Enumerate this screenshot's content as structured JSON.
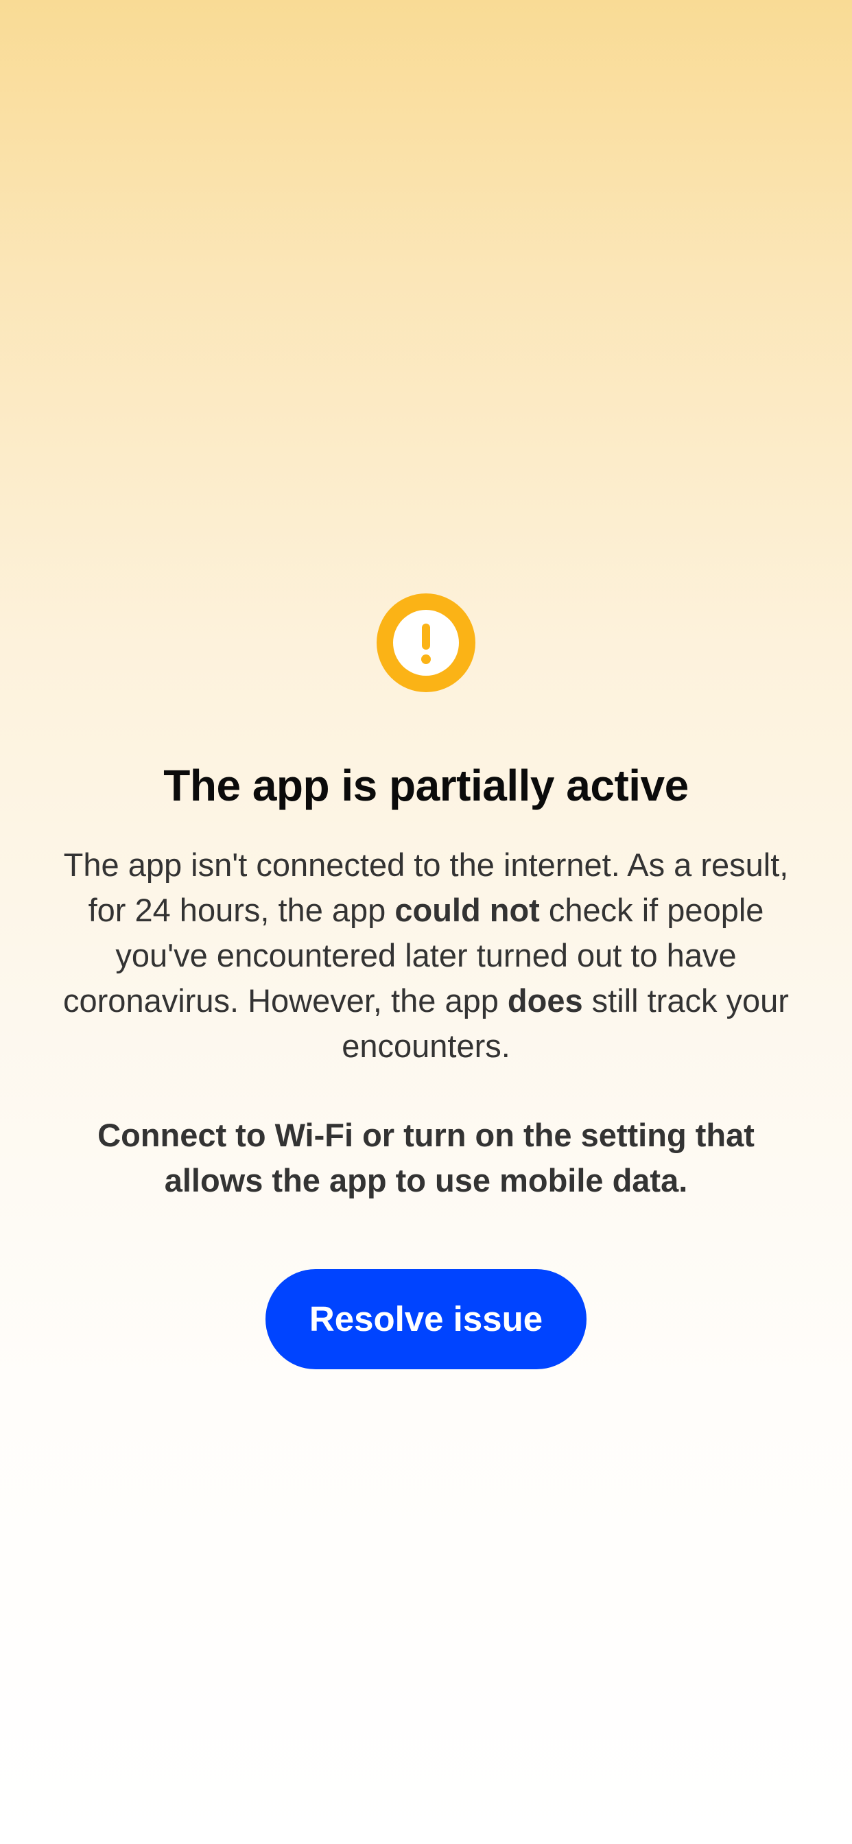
{
  "status": {
    "icon": "exclamation-circle-icon",
    "icon_color": "#fbb316",
    "title": "The app is partially active"
  },
  "message": {
    "part1": "The app isn't connected to the internet. As a result, for 24 hours, the app ",
    "bold1": "could not",
    "part2": " check if people you've encountered later turned out to have coronavirus. However, the app ",
    "bold2": "does",
    "part3": " still track your encounters."
  },
  "instruction": "Connect to Wi-Fi or turn on the setting that allows the app to use mobile data.",
  "actions": {
    "resolve_label": "Resolve issue",
    "button_color": "#0044ff"
  }
}
